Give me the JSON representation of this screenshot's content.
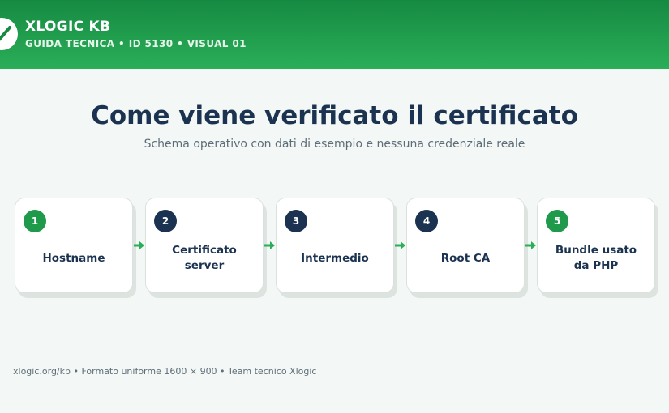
{
  "header": {
    "brand": "XLOGIC KB",
    "subtitle": "GUIDA TECNICA • ID 5130 • VISUAL 01",
    "logo_icon": "checkmark-icon"
  },
  "main": {
    "title": "Come viene verificato il certificato",
    "lead": "Schema operativo con dati di esempio e nessuna credenziale reale"
  },
  "steps": [
    {
      "number": "1",
      "label": "Hostname",
      "badge_color": "#1f9a4b"
    },
    {
      "number": "2",
      "label": "Certificato\nserver",
      "badge_color": "#1b3350"
    },
    {
      "number": "3",
      "label": "Intermedio",
      "badge_color": "#1b3350"
    },
    {
      "number": "4",
      "label": "Root CA",
      "badge_color": "#1b3350"
    },
    {
      "number": "5",
      "label": "Bundle usato\nda PHP",
      "badge_color": "#1f9a4b"
    }
  ],
  "arrow_icon": "arrow-right-icon",
  "footer": {
    "text": "xlogic.org/kb • Formato uniforme 1600 × 900 • Team tecnico Xlogic"
  },
  "colors": {
    "brand_green": "#1f9a4b",
    "navy": "#1b3350",
    "background": "#f3f7f5"
  }
}
